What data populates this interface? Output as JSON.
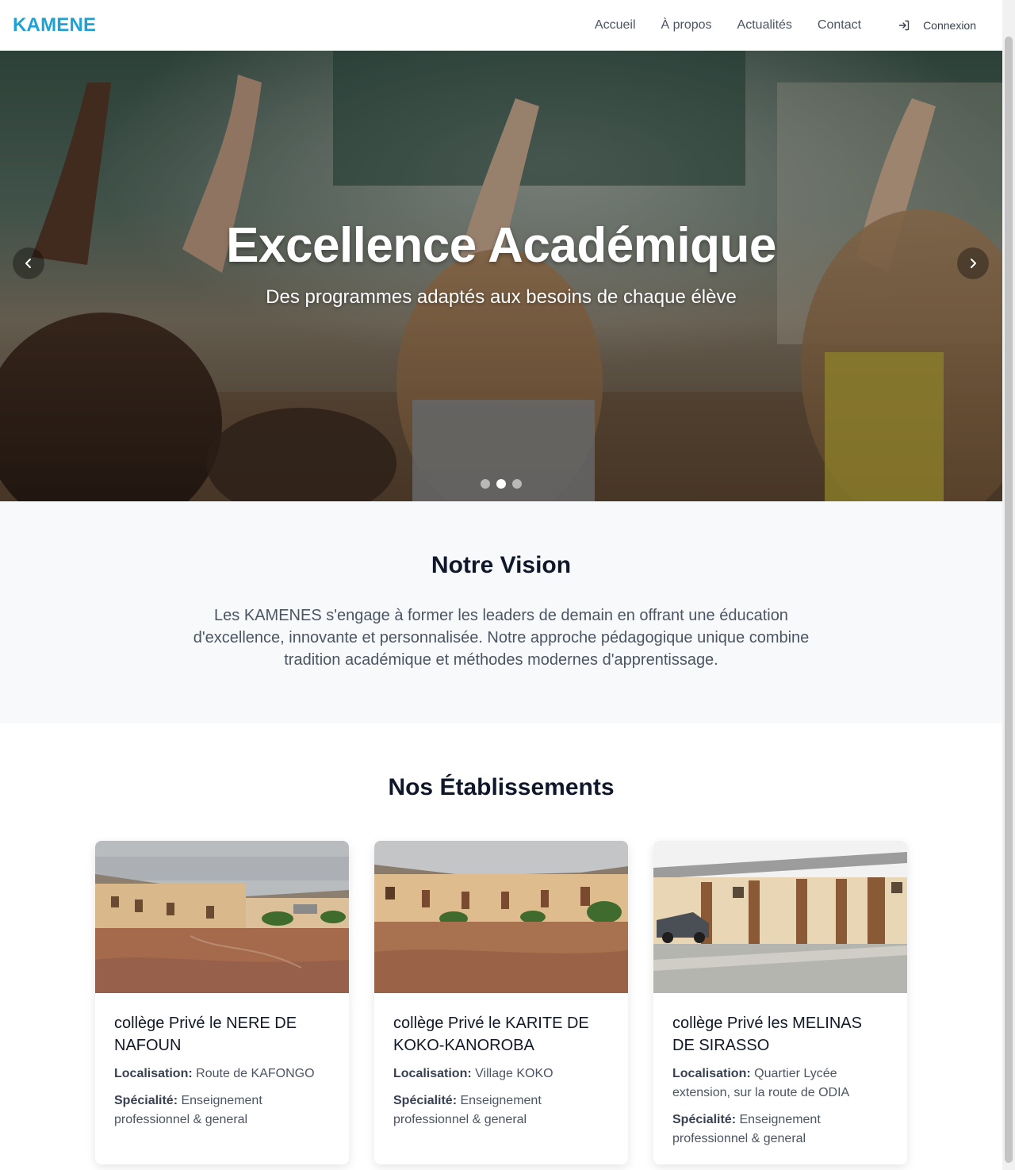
{
  "nav": {
    "brand": "KAMENE",
    "links": [
      "Accueil",
      "À propos",
      "Actualités",
      "Contact"
    ],
    "login_label": "Connexion"
  },
  "hero": {
    "title": "Excellence Académique",
    "subtitle": "Des programmes adaptés aux besoins de chaque élève",
    "slides_count": 3,
    "active_slide": 2
  },
  "vision": {
    "title": "Notre Vision",
    "text": "Les KAMENES s'engage à former les leaders de demain en offrant une éducation d'excellence, innovante et personnalisée. Notre approche pédagogique unique combine tradition académique et méthodes modernes d'apprentissage."
  },
  "establishments": {
    "title": "Nos Établissements",
    "location_label": "Localisation:",
    "specialty_label": "Spécialité:",
    "items": [
      {
        "name": "collège Privé le NERE DE NAFOUN",
        "location": "Route de KAFONGO",
        "specialty": "Enseignement professionnel & general"
      },
      {
        "name": "collège Privé le KARITE DE KOKO-KANOROBA",
        "location": "Village KOKO",
        "specialty": "Enseignement professionnel & general"
      },
      {
        "name": "collège Privé les MELINAS DE SIRASSO",
        "location": "Quartier Lycée extension, sur la route de ODIA",
        "specialty": "Enseignement professionnel & general"
      }
    ]
  },
  "colors": {
    "brand": "#1ea2d6",
    "section_bg": "#f8f9fb",
    "heading": "#0f172a",
    "body_text": "#4b5563"
  }
}
